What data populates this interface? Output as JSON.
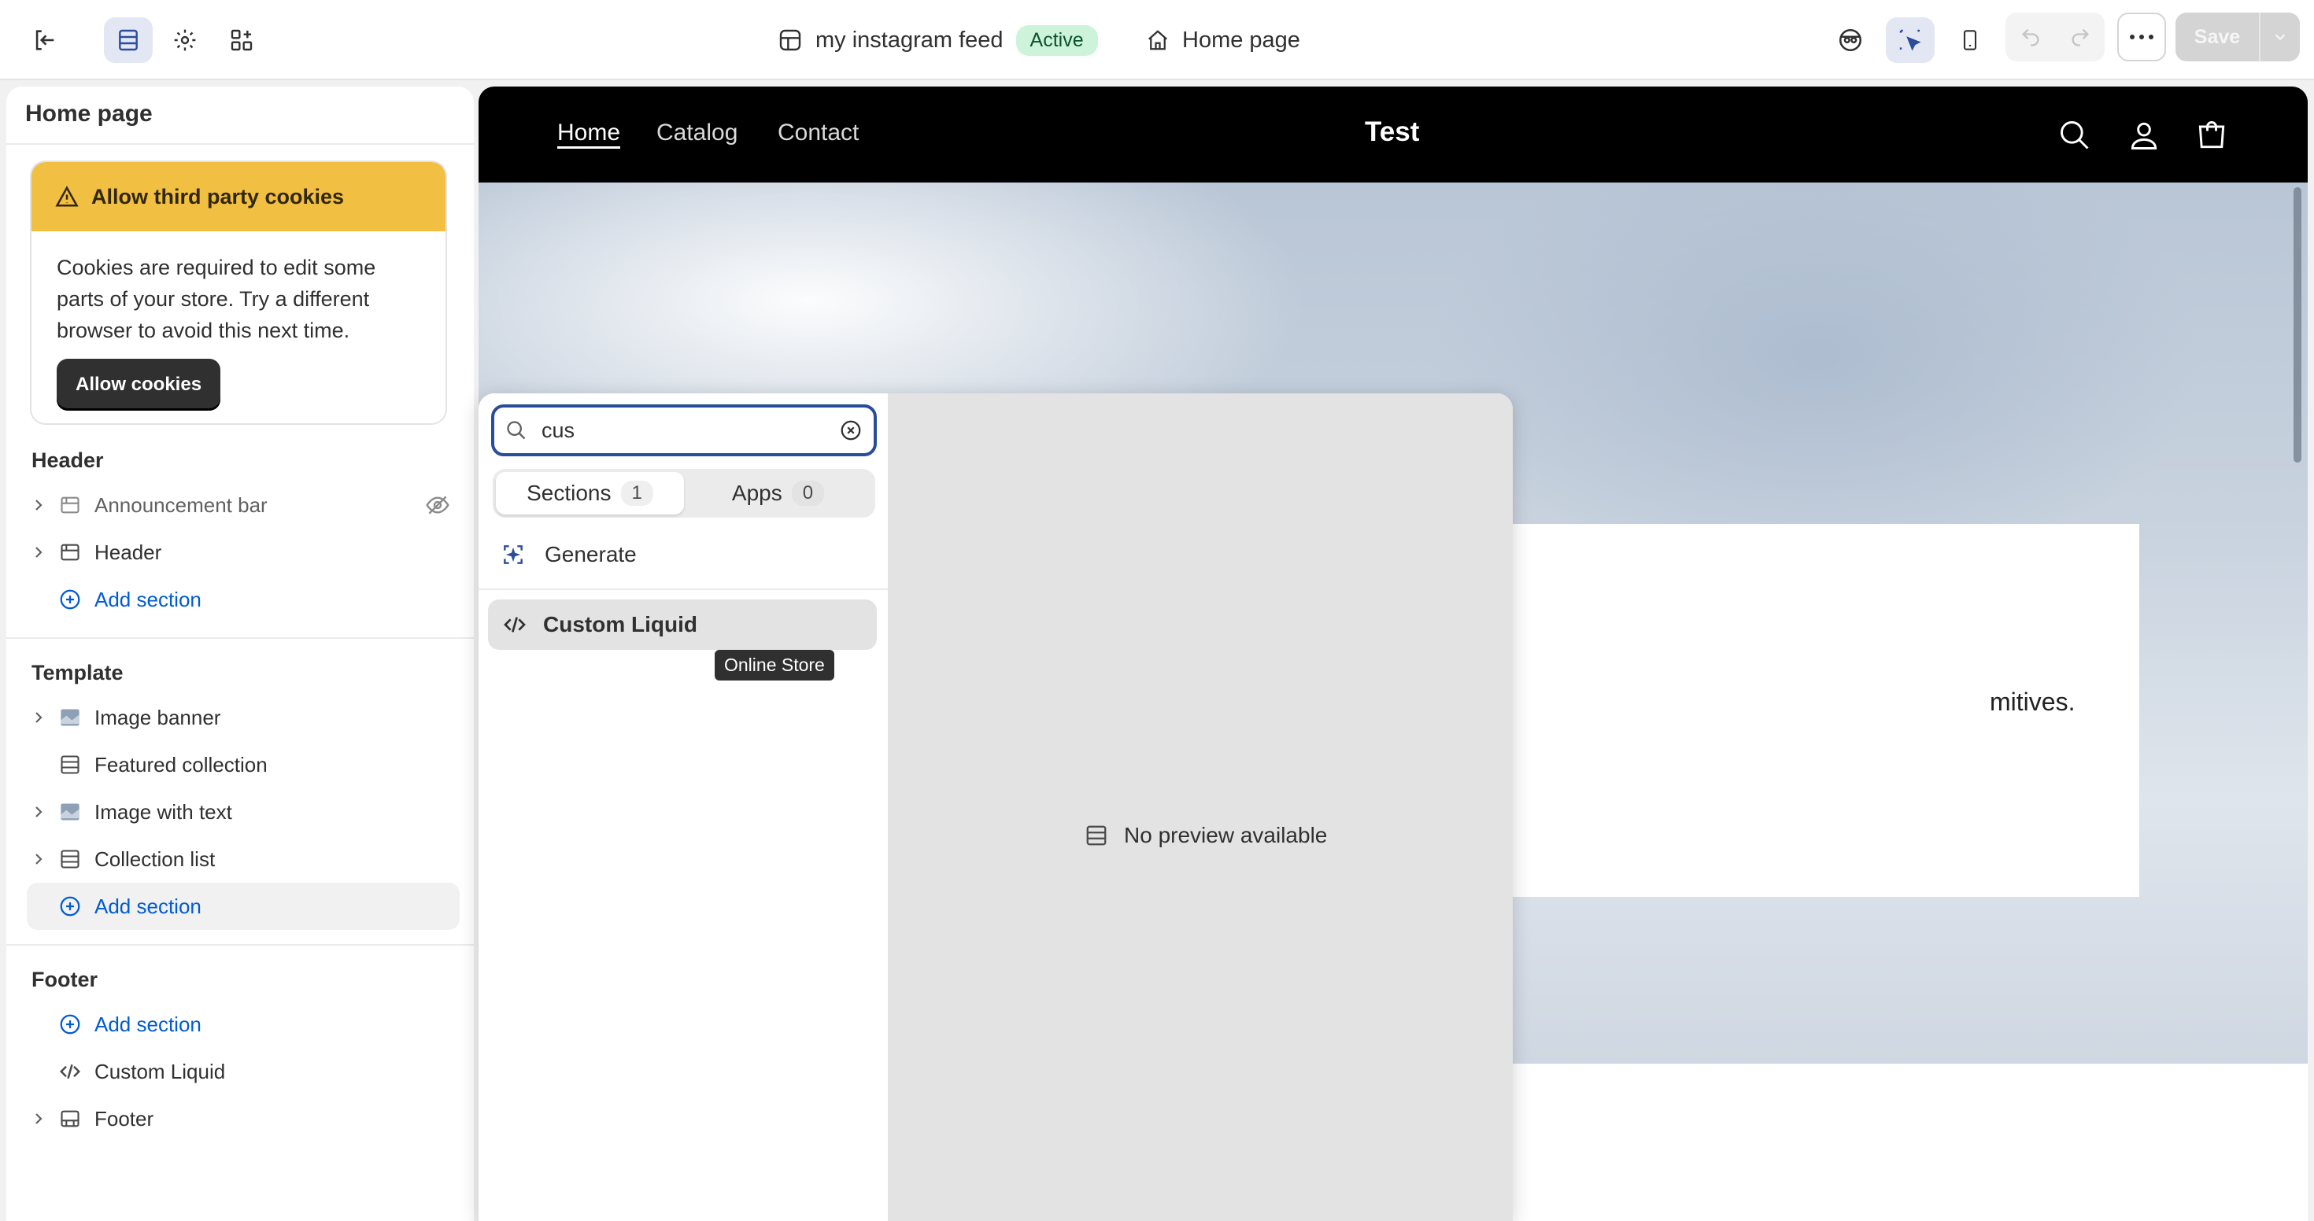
{
  "topbar": {
    "exit_icon": "exit-icon",
    "theme_name": "my instagram feed",
    "theme_status": "Active",
    "page_name": "Home page",
    "save_label": "Save"
  },
  "sidebar": {
    "title": "Home page",
    "cookie_notice": {
      "title": "Allow third party cookies",
      "body": "Cookies are required to edit some parts of your store. Try a different browser to avoid this next time.",
      "button": "Allow cookies"
    },
    "header_group": {
      "title": "Header",
      "items": [
        {
          "label": "Announcement bar",
          "hidden": true
        },
        {
          "label": "Header"
        }
      ],
      "add_label": "Add section"
    },
    "template_group": {
      "title": "Template",
      "items": [
        {
          "label": "Image banner"
        },
        {
          "label": "Featured collection"
        },
        {
          "label": "Image with text"
        },
        {
          "label": "Collection list"
        }
      ],
      "add_label": "Add section"
    },
    "footer_group": {
      "title": "Footer",
      "add_label": "Add section",
      "items": [
        {
          "label": "Custom Liquid"
        },
        {
          "label": "Footer"
        }
      ]
    }
  },
  "preview": {
    "nav_links": [
      "Home",
      "Catalog",
      "Contact"
    ],
    "store_title": "Test",
    "hero_text_fragment": "mitives."
  },
  "picker": {
    "search_value": "cus",
    "tabs": [
      {
        "label": "Sections",
        "count": "1"
      },
      {
        "label": "Apps",
        "count": "0"
      }
    ],
    "generate_label": "Generate",
    "result_label": "Custom Liquid",
    "tooltip": "Online Store",
    "no_preview": "No preview available"
  }
}
